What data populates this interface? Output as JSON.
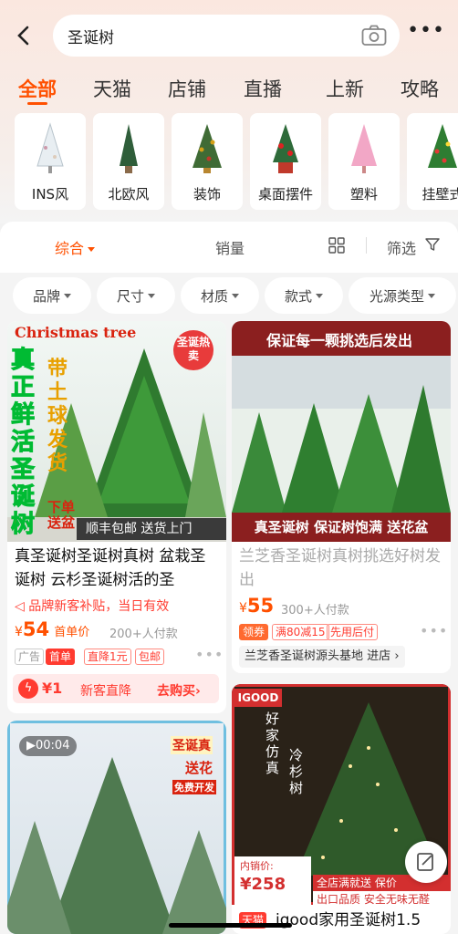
{
  "search": {
    "query": "圣诞树"
  },
  "tabs": [
    "全部",
    "天猫",
    "店铺",
    "直播",
    "上新",
    "攻略"
  ],
  "categories": [
    "INS风",
    "北欧风",
    "装饰",
    "桌面摆件",
    "塑料",
    "挂壁式"
  ],
  "sort": {
    "comprehensive": "综合",
    "sales": "销量",
    "filter": "筛选"
  },
  "filter_chips": [
    "品牌",
    "尺寸",
    "材质",
    "款式",
    "光源类型"
  ],
  "products": [
    {
      "image_text": {
        "top": "Christmas tree",
        "badge": "圣诞热卖",
        "vertical": "真正鲜活圣诞树",
        "side": "带土球发货",
        "order": "下单送盆",
        "bottom": "顺丰包邮  送货上门"
      },
      "title": "真圣诞树圣诞树真树 盆栽圣诞树 云杉圣诞树活的圣",
      "subsidy": "品牌新客补贴，当日有效",
      "price": "54",
      "price_prefix": "¥",
      "price_label": "首单价",
      "sold": "200+人付款",
      "tags": [
        "广告",
        "首单",
        "直降1元",
        "包邮"
      ],
      "promo": {
        "amount": "¥1",
        "label": "新客直降",
        "action": "去购买"
      }
    },
    {
      "image_text": {
        "top": "保证每一颗挑选后发出",
        "bottom": "真圣诞树 保证树饱满 送花盆"
      },
      "title": "兰芝香圣诞树真树挑选好树发出",
      "price": "55",
      "price_prefix": "¥",
      "sold": "300+人付款",
      "tags": [
        "领券",
        "满80减15",
        "先用后付"
      ],
      "shop": "兰芝香圣诞树源头基地",
      "shop_action": "进店"
    },
    {
      "video_time": "00:04",
      "image_text": {
        "line1": "圣诞真",
        "line2": "送花",
        "line3": "免费开发"
      }
    },
    {
      "image_text": {
        "brand": "IGOOD",
        "vertical1": "好家仿真",
        "vertical2": "冷杉树",
        "price_label": "内销价:",
        "price": "¥258",
        "promo": "全店满就送 保价",
        "promo2": "出口品质 安全无味无醛"
      },
      "badge": "天猫",
      "title": "igood家用圣诞树1.5"
    }
  ]
}
